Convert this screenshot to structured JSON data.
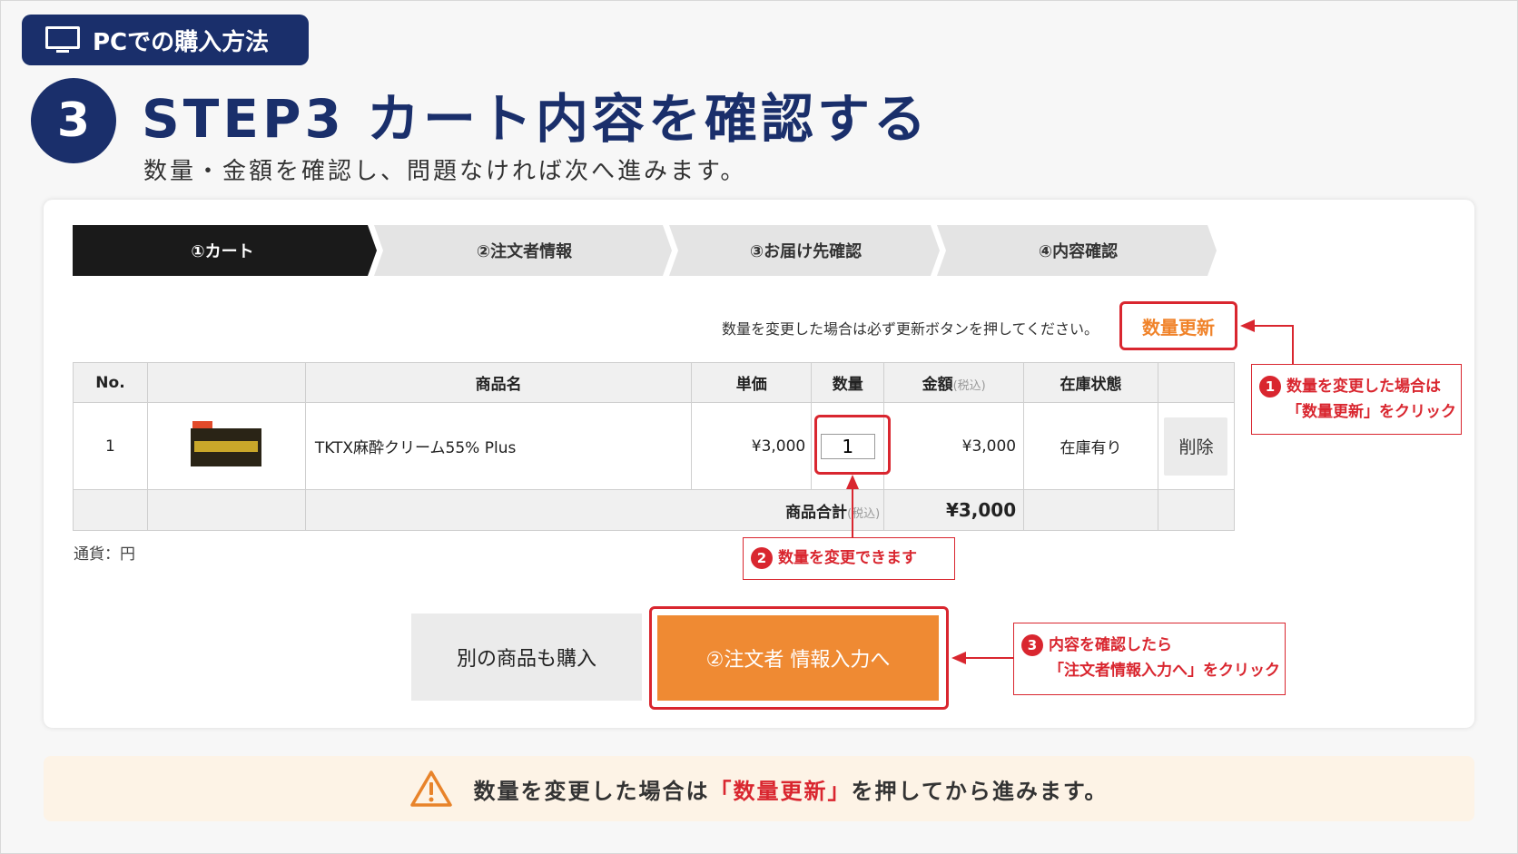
{
  "header": {
    "badge_label": "PCでの購入方法",
    "step_number": "3",
    "title": "STEP3 カート内容を確認する",
    "subtitle": "数量・金額を確認し、問題なければ次へ進みます。"
  },
  "progress": [
    {
      "label": "①カート",
      "active": true
    },
    {
      "label": "②注文者情報",
      "active": false
    },
    {
      "label": "③お届け先確認",
      "active": false
    },
    {
      "label": "④内容確認",
      "active": false
    }
  ],
  "cart": {
    "notice": "数量を変更した場合は必ず更新ボタンを押してください。",
    "update_button": "数量更新",
    "headers": {
      "no": "No.",
      "name": "商品名",
      "unit_price": "単価",
      "quantity": "数量",
      "amount": "金額",
      "tax_note": "(税込)",
      "stock": "在庫状態"
    },
    "item": {
      "no": "1",
      "name": "TKTX麻酔クリーム55% Plus",
      "unit_price": "¥3,000",
      "quantity": "1",
      "amount": "¥3,000",
      "stock": "在庫有り",
      "delete_label": "削除"
    },
    "total_label": "商品合計",
    "total_tax_note": "(税込)",
    "total_amount": "¥3,000",
    "currency": "通貨：円"
  },
  "actions": {
    "other_label": "別の商品も購入",
    "next_label": "②注文者 情報入力へ"
  },
  "callouts": {
    "c1_num": "1",
    "c1_line1": "数量を変更した場合は",
    "c1_line2": "「数量更新」をクリック",
    "c2_num": "2",
    "c2_text": "数量を変更できます",
    "c3_num": "3",
    "c3_line1": "内容を確認したら",
    "c3_line2": "「注文者情報入力へ」をクリック"
  },
  "banner": {
    "before": "数量を変更した場合は",
    "highlight": "「数量更新」",
    "after": "を押してから進みます。"
  },
  "colors": {
    "navy": "#1a2f6b",
    "accent_orange": "#ef8a33",
    "highlight_red": "#d9262f",
    "banner_bg": "#fdf3e6"
  }
}
